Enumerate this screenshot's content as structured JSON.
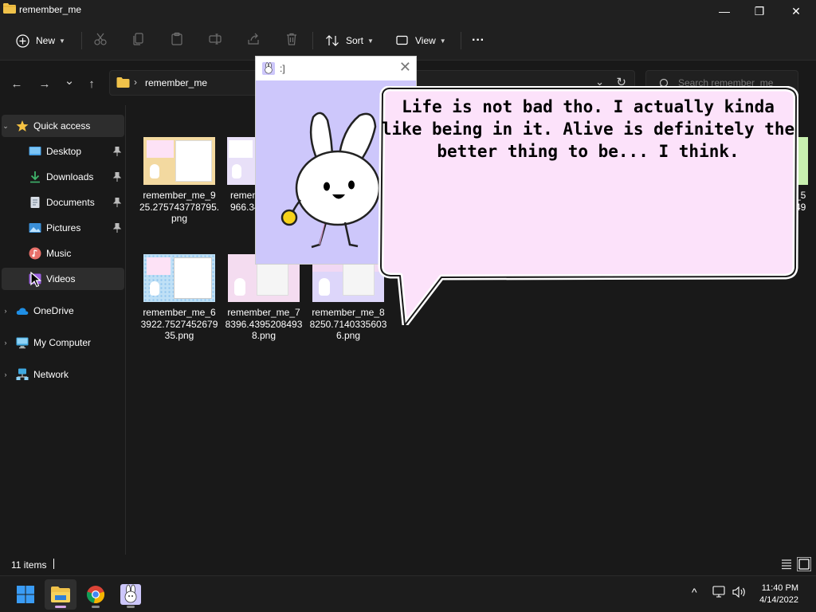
{
  "window": {
    "title": "remember_me",
    "minimize_glyph": "—",
    "maximize_glyph": "❐",
    "close_glyph": "✕"
  },
  "toolbar": {
    "new_label": "New",
    "sort_label": "Sort",
    "view_label": "View",
    "more_label": "···",
    "icons": [
      "cut-icon",
      "copy-icon",
      "paste-icon",
      "rename-icon",
      "share-icon",
      "delete-icon"
    ]
  },
  "nav": {
    "back": "←",
    "forward": "→",
    "recent": "⌄",
    "up": "↑",
    "breadcrumb": "remember_me",
    "search_placeholder": "Search remember_me"
  },
  "sidebar": {
    "quick_access": "Quick access",
    "items": [
      {
        "label": "Desktop",
        "icon": "desktop-icon",
        "pinned": true
      },
      {
        "label": "Downloads",
        "icon": "downloads-icon",
        "pinned": true
      },
      {
        "label": "Documents",
        "icon": "documents-icon",
        "pinned": true
      },
      {
        "label": "Pictures",
        "icon": "pictures-icon",
        "pinned": true
      },
      {
        "label": "Music",
        "icon": "music-icon",
        "pinned": false
      },
      {
        "label": "Videos",
        "icon": "videos-icon",
        "pinned": false
      }
    ],
    "roots": [
      {
        "label": "OneDrive",
        "icon": "cloud-icon"
      },
      {
        "label": "My Computer",
        "icon": "computer-icon"
      },
      {
        "label": "Network",
        "icon": "network-icon"
      }
    ]
  },
  "files": [
    {
      "line1": "remember_me_9",
      "line2": "25.275743778795.",
      "line3": "png",
      "bg": "#f3d9a0"
    },
    {
      "line1": "remem",
      "line2": "966.34",
      "line3": "",
      "bg": "#e8e0f8"
    },
    {
      "line1": "_5",
      "line2": "49",
      "line3": "",
      "bg": "#c8f0b0"
    },
    {
      "line1": "remember_me_6",
      "line2": "3922.7527452679",
      "line3": "35.png",
      "bg": "#bfe0f6"
    },
    {
      "line1": "remember_me_7",
      "line2": "8396.4395208493",
      "line3": "8.png",
      "bg": "#f4dcf0"
    },
    {
      "line1": "remember_me_8",
      "line2": "8250.7140335603",
      "line3": "6.png",
      "bg": "#ddd6fa"
    }
  ],
  "status": {
    "count": "11 items"
  },
  "popup": {
    "title": ":]",
    "close_glyph": "✕"
  },
  "bubble": {
    "text": "Life is not bad tho. I actually kinda like being in it. Alive is definitely the better thing to be... I think."
  },
  "taskbar": {
    "apps": [
      "start-icon",
      "file-explorer-icon",
      "chrome-icon",
      "bunny-app-icon"
    ],
    "tray_chevron": "^",
    "time": "11:40 PM",
    "date": "4/14/2022"
  },
  "colors": {
    "accent_folder": "#f0c24a",
    "bubble_fill": "#fce2fa",
    "popup_body": "#cdc7fb"
  }
}
